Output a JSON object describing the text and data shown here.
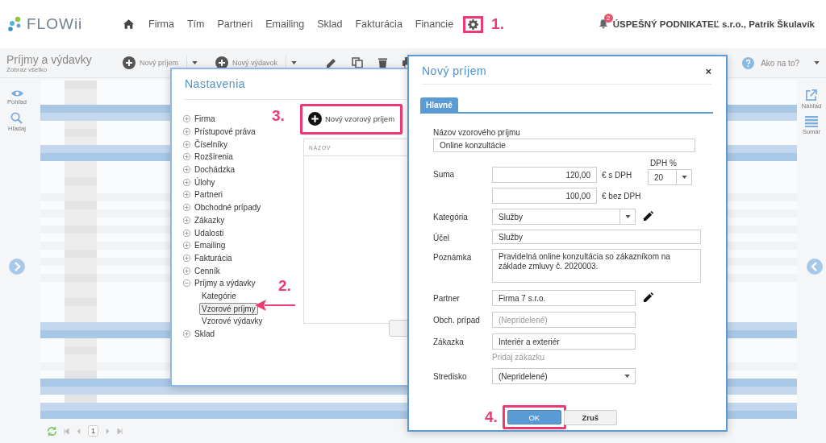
{
  "header": {
    "logo": "FLOWii",
    "nav": [
      "Firma",
      "Tím",
      "Partneri",
      "Emailing",
      "Sklad",
      "Fakturácia",
      "Financie"
    ],
    "notification_count": "2",
    "company": "ÚSPEŠNÝ PODNIKATEĽ s.r.o., Patrik Škulavík"
  },
  "toolbar": {
    "title": "Príjmy a výdavky",
    "subtitle": "Zobraz všetko",
    "buttons": [
      "Nový príjem",
      "Nový výdavok"
    ],
    "help": "Ako na to?"
  },
  "left_rail": [
    "Pohľad",
    "Hľadaj"
  ],
  "right_rail": [
    "Náhľad",
    "Sumár"
  ],
  "pager": {
    "page": "1"
  },
  "settings_dialog": {
    "title": "Nastavenia",
    "new_button": "Nový vzorový príjem",
    "columns": [
      "NÁZOV"
    ],
    "tree": [
      {
        "label": "Firma",
        "expanded": false
      },
      {
        "label": "Prístupové práva",
        "expanded": false
      },
      {
        "label": "Číselníky",
        "expanded": false
      },
      {
        "label": "Rozšírenia",
        "expanded": false
      },
      {
        "label": "Dochádzka",
        "expanded": false
      },
      {
        "label": "Úlohy",
        "expanded": false
      },
      {
        "label": "Partneri",
        "expanded": false
      },
      {
        "label": "Obchodné prípady",
        "expanded": false
      },
      {
        "label": "Zákazky",
        "expanded": false
      },
      {
        "label": "Udalosti",
        "expanded": false
      },
      {
        "label": "Emailing",
        "expanded": false
      },
      {
        "label": "Fakturácia",
        "expanded": false
      },
      {
        "label": "Cenník",
        "expanded": false
      },
      {
        "label": "Príjmy a výdavky",
        "expanded": true,
        "children": [
          {
            "label": "Kategórie",
            "selected": false
          },
          {
            "label": "Vzorové príjmy",
            "selected": true
          },
          {
            "label": "Vzorové výdavky",
            "selected": false
          }
        ]
      },
      {
        "label": "Sklad",
        "expanded": false
      }
    ]
  },
  "income_dialog": {
    "title": "Nový príjem",
    "close": "×",
    "tabs": [
      {
        "label": "Hlavné",
        "selected": true
      }
    ],
    "form": [
      {
        "kind": "title",
        "label": "Názov vzorového príjmu",
        "value": "Online konzultácie"
      },
      {
        "kind": "amount",
        "label": "Suma",
        "gross": "120,00",
        "gross_unit": "€ s DPH",
        "net": "100,00",
        "net_unit": "€ bez DPH",
        "vat_label": "DPH %",
        "vat": "20"
      },
      {
        "kind": "combo",
        "label": "Kategória",
        "value": "Služby",
        "edit": true
      },
      {
        "kind": "text",
        "label": "Účel",
        "value": "Služby"
      },
      {
        "kind": "textarea",
        "label": "Poznámka",
        "value": "Pravidelná online konzultácia so zákazníkom na základe zmluvy č. 2020003."
      },
      {
        "kind": "lookup",
        "label": "Partner",
        "value": "Firma 7 s.r.o.",
        "edit": true
      },
      {
        "kind": "lookup",
        "label": "Obch. prípad",
        "placeholder": "(Nepridelené)"
      },
      {
        "kind": "lookup",
        "label": "Zákazka",
        "value": "Interiér a exteriér",
        "link": "Pridaj zákazku"
      },
      {
        "kind": "select",
        "label": "Stredisko",
        "value": "(Nepridelené)"
      }
    ],
    "buttons": [
      "OK",
      "Zruš"
    ]
  },
  "annotations": [
    "1.",
    "2.",
    "3.",
    "4."
  ]
}
